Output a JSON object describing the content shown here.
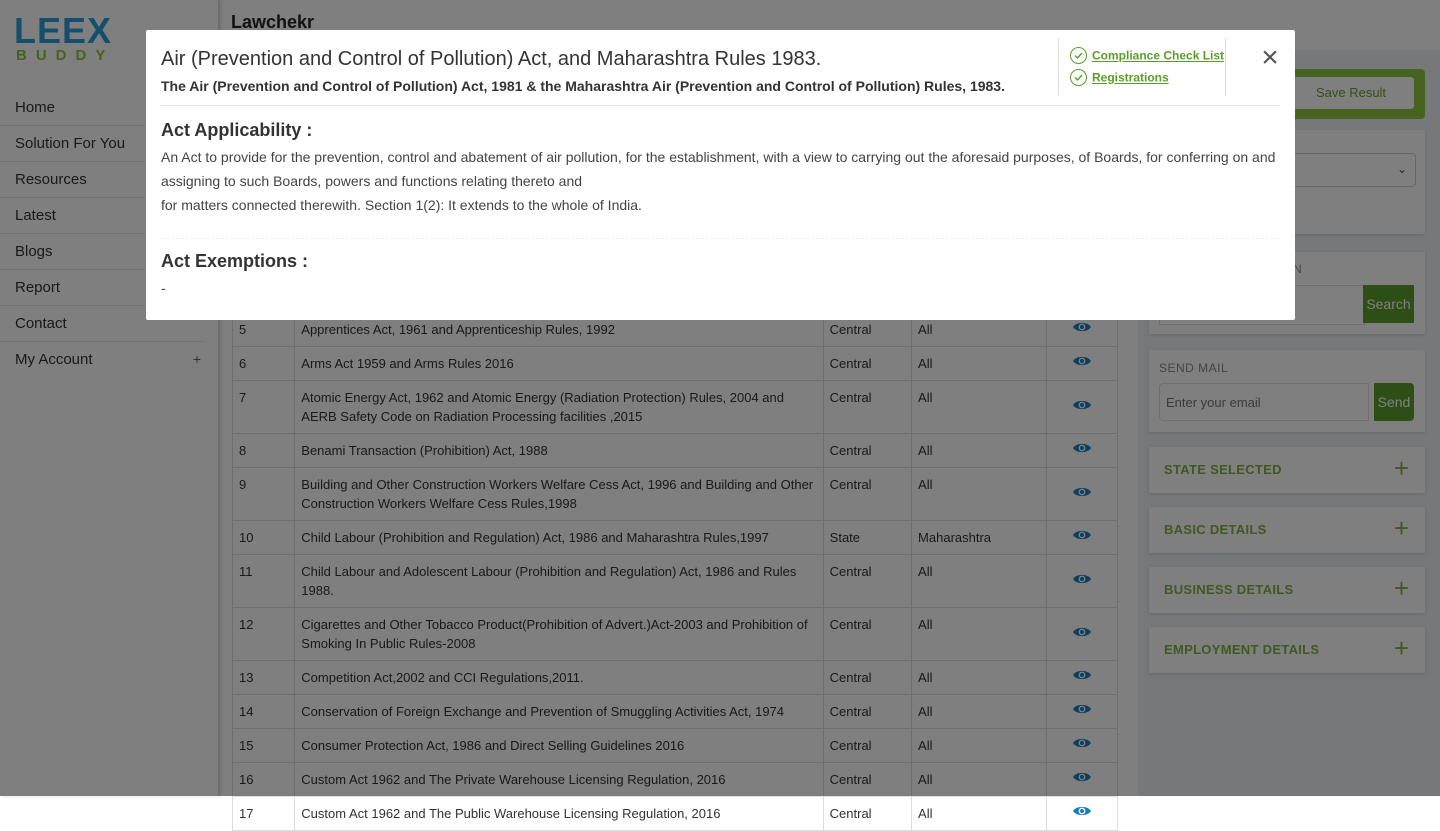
{
  "brand": {
    "logo_top": "LEEX",
    "logo_bottom": "BUDDY"
  },
  "sidebar": {
    "items": [
      {
        "label": "Home"
      },
      {
        "label": "Solution For You"
      },
      {
        "label": "Resources"
      },
      {
        "label": "Latest"
      },
      {
        "label": "Blogs"
      },
      {
        "label": "Report"
      },
      {
        "label": "Contact"
      },
      {
        "label": "My Account",
        "toggle": "+"
      }
    ]
  },
  "header": {
    "title": "Lawchekr"
  },
  "table": {
    "rows": [
      {
        "num": "5",
        "name": "Apprentices Act, 1961 and Apprenticeship Rules, 1992",
        "type": "Central",
        "state": "All"
      },
      {
        "num": "6",
        "name": "Arms Act 1959 and Arms Rules 2016",
        "type": "Central",
        "state": "All"
      },
      {
        "num": "7",
        "name": "Atomic Energy Act, 1962 and Atomic Energy (Radiation Protection) Rules, 2004 and AERB Safety Code on Radiation Processing facilities ,2015",
        "type": "Central",
        "state": "All"
      },
      {
        "num": "8",
        "name": "Benami Transaction (Prohibition) Act, 1988",
        "type": "Central",
        "state": "All"
      },
      {
        "num": "9",
        "name": "Building and Other Construction Workers Welfare Cess Act, 1996 and Building and Other Construction Workers Welfare Cess Rules,1998",
        "type": "Central",
        "state": "All"
      },
      {
        "num": "10",
        "name": "Child Labour (Prohibition and Regulation) Act, 1986 and Maharashtra Rules,1997",
        "type": "State",
        "state": "Maharashtra"
      },
      {
        "num": "11",
        "name": "Child Labour and Adolescent Labour (Prohibition and Regulation) Act, 1986 and Rules 1988.",
        "type": "Central",
        "state": "All"
      },
      {
        "num": "12",
        "name": "Cigarettes and Other Tobacco Product(Prohibition of Advert.)Act-2003 and Prohibition of Smoking In Public Rules-2008",
        "type": "Central",
        "state": "All"
      },
      {
        "num": "13",
        "name": "Competition Act,2002 and CCI Regulations,2011.",
        "type": "Central",
        "state": "All"
      },
      {
        "num": "14",
        "name": "Conservation of Foreign Exchange and Prevention of Smuggling Activities Act, 1974",
        "type": "Central",
        "state": "All"
      },
      {
        "num": "15",
        "name": "Consumer Protection Act, 1986 and Direct Selling Guidelines 2016",
        "type": "Central",
        "state": "All"
      },
      {
        "num": "16",
        "name": "Custom Act 1962 and The Private Warehouse Licensing Regulation, 2016",
        "type": "Central",
        "state": "All"
      },
      {
        "num": "17",
        "name": "Custom Act 1962 and The Public Warehouse Licensing Regulation, 2016",
        "type": "Central",
        "state": "All"
      }
    ]
  },
  "right_panel": {
    "save_label": "Save Result",
    "search_label": "N",
    "search_button": "Search",
    "mail_label": "SEND MAIL",
    "mail_placeholder": "Enter your email",
    "mail_button": "Send",
    "accordions": [
      {
        "label": "STATE SELECTED",
        "icon": "+"
      },
      {
        "label": "BASIC DETAILS",
        "icon": "+"
      },
      {
        "label": "BUSINESS DETAILS",
        "icon": "+"
      },
      {
        "label": "EMPLOYMENT DETAILS",
        "icon": "+"
      }
    ],
    "accent_color": "#8dc63f"
  },
  "modal": {
    "title": "Air (Prevention and Control of Pollution) Act, and Maharashtra Rules 1983.",
    "subtitle": "The Air (Prevention and Control of Pollution) Act, 1981 & the Maharashtra Air (Prevention and Control of Pollution) Rules, 1983.",
    "links": [
      {
        "label": "Compliance Check List"
      },
      {
        "label": "Registrations"
      }
    ],
    "close_glyph": "×",
    "applicability_heading": "Act Applicability :",
    "applicability_line1": "An Act to provide for the prevention, control and abatement of air pollution, for the establishment, with a view to carrying out the aforesaid purposes, of Boards, for conferring on and assigning to such Boards, powers and functions relating thereto and",
    "applicability_line2": "for matters connected therewith. Section 1(2): It extends to the whole of India.",
    "exemptions_heading": "Act Exemptions :",
    "exemptions_text": "-"
  }
}
